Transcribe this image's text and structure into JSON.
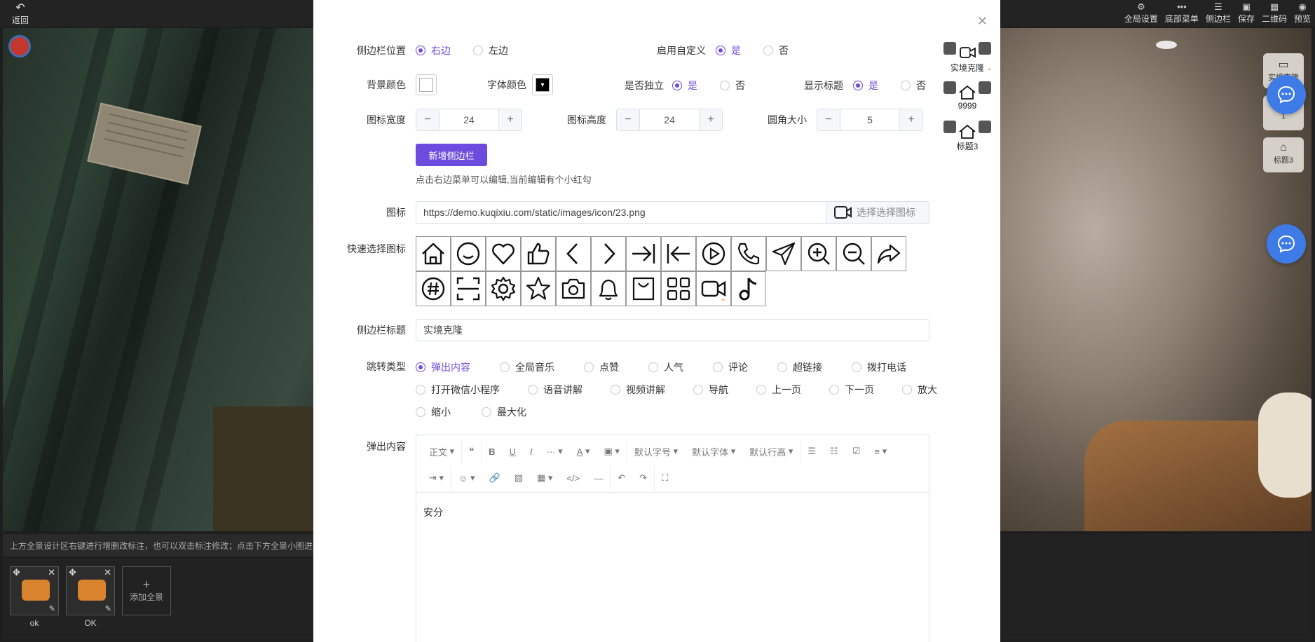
{
  "topbar": {
    "back_label": "返回",
    "menu": [
      {
        "icon": "gear-icon",
        "label": "全局设置"
      },
      {
        "icon": "more-icon",
        "label": "底部菜单"
      },
      {
        "icon": "list-icon",
        "label": "侧边栏"
      },
      {
        "icon": "save-icon",
        "label": "保存"
      },
      {
        "icon": "qrcode-icon",
        "label": "二维码"
      },
      {
        "icon": "eye-icon",
        "label": "预览"
      }
    ]
  },
  "bottom": {
    "hint": "上方全景设计区右键进行增删改标注，也可以双击标注修改；点击下方全景小图进",
    "thumbs": [
      {
        "label": "ok"
      },
      {
        "label": "OK"
      }
    ],
    "add_label": "添加全景"
  },
  "right_side": {
    "buttons": [
      {
        "label": "实境克隆"
      },
      {
        "label": "1"
      },
      {
        "label": "标题3"
      }
    ]
  },
  "modal": {
    "position": {
      "label": "侧边栏位置",
      "options": [
        {
          "label": "右边",
          "checked": true
        },
        {
          "label": "左边",
          "checked": false
        }
      ]
    },
    "custom": {
      "label": "启用自定义",
      "options": [
        {
          "label": "是",
          "checked": true
        },
        {
          "label": "否",
          "checked": false
        }
      ]
    },
    "bg_color": {
      "label": "背景颜色",
      "value": "#ffffff"
    },
    "font_color": {
      "label": "字体颜色",
      "value": "#000000"
    },
    "independent": {
      "label": "是否独立",
      "options": [
        {
          "label": "是",
          "checked": true
        },
        {
          "label": "否",
          "checked": false
        }
      ]
    },
    "show_title": {
      "label": "显示标题",
      "options": [
        {
          "label": "是",
          "checked": true
        },
        {
          "label": "否",
          "checked": false
        }
      ]
    },
    "icon_width": {
      "label": "图标宽度",
      "value": "24",
      "minus": "−",
      "plus": "+"
    },
    "icon_height": {
      "label": "图标高度",
      "value": "24",
      "minus": "−",
      "plus": "+"
    },
    "radius": {
      "label": "圆角大小",
      "value": "5",
      "minus": "−",
      "plus": "+"
    },
    "add_button": "新增侧边栏",
    "edit_hint": "点击右边菜单可以编辑,当前编辑有个小红勾",
    "icon": {
      "label": "图标",
      "url": "https://demo.kuqixiu.com/static/images/icon/23.png",
      "pick_label": "选择选择图标"
    },
    "quick_icons": {
      "label": "快速选择图标",
      "icons": [
        "home-icon",
        "smile-icon",
        "heart-icon",
        "thumbs-up-icon",
        "chevron-left-icon",
        "chevron-right-icon",
        "arrow-right-bar-icon",
        "arrow-left-bar-icon",
        "play-icon",
        "phone-icon",
        "send-icon",
        "zoom-in-icon",
        "zoom-out-icon",
        "share-icon",
        "hashtag-icon",
        "scan-icon",
        "gear-icon",
        "star-icon",
        "camera-icon",
        "bell-icon",
        "bag-icon",
        "grid-icon",
        "video-icon",
        "music-note-icon"
      ],
      "selected": "video-icon"
    },
    "title": {
      "label": "侧边栏标题",
      "value": "实境克隆"
    },
    "jump_type": {
      "label": "跳转类型",
      "options": [
        {
          "label": "弹出内容",
          "checked": true
        },
        {
          "label": "全局音乐",
          "checked": false
        },
        {
          "label": "点赞",
          "checked": false
        },
        {
          "label": "人气",
          "checked": false
        },
        {
          "label": "评论",
          "checked": false
        },
        {
          "label": "超链接",
          "checked": false
        },
        {
          "label": "拨打电话",
          "checked": false
        },
        {
          "label": "打开微信小程序",
          "checked": false
        },
        {
          "label": "语音讲解",
          "checked": false
        },
        {
          "label": "视频讲解",
          "checked": false
        },
        {
          "label": "导航",
          "checked": false
        },
        {
          "label": "上一页",
          "checked": false
        },
        {
          "label": "下一页",
          "checked": false
        },
        {
          "label": "放大",
          "checked": false
        },
        {
          "label": "缩小",
          "checked": false
        },
        {
          "label": "最大化",
          "checked": false
        }
      ]
    },
    "popup": {
      "label": "弹出内容",
      "toolbar": [
        "正文",
        "❝",
        "B",
        "U",
        "I",
        "···",
        "A",
        "▣",
        "默认字号",
        "默认字体",
        "默认行高",
        "☰",
        "☷",
        "☑",
        "≡",
        "⇥",
        "☺",
        "🔗",
        "▨",
        "▦",
        "</>",
        "―",
        "↶",
        "↷",
        "⛶"
      ],
      "content": "安分"
    },
    "preview": [
      {
        "label": "实境克隆",
        "icon": "video-icon",
        "selected": true
      },
      {
        "label": "9999",
        "icon": "home-icon",
        "selected": false
      },
      {
        "label": "标题3",
        "icon": "home-icon",
        "selected": false
      }
    ]
  },
  "colors": {
    "accent": "#6c4bde",
    "chat": "#3f7be6",
    "check": "#e8731e"
  }
}
